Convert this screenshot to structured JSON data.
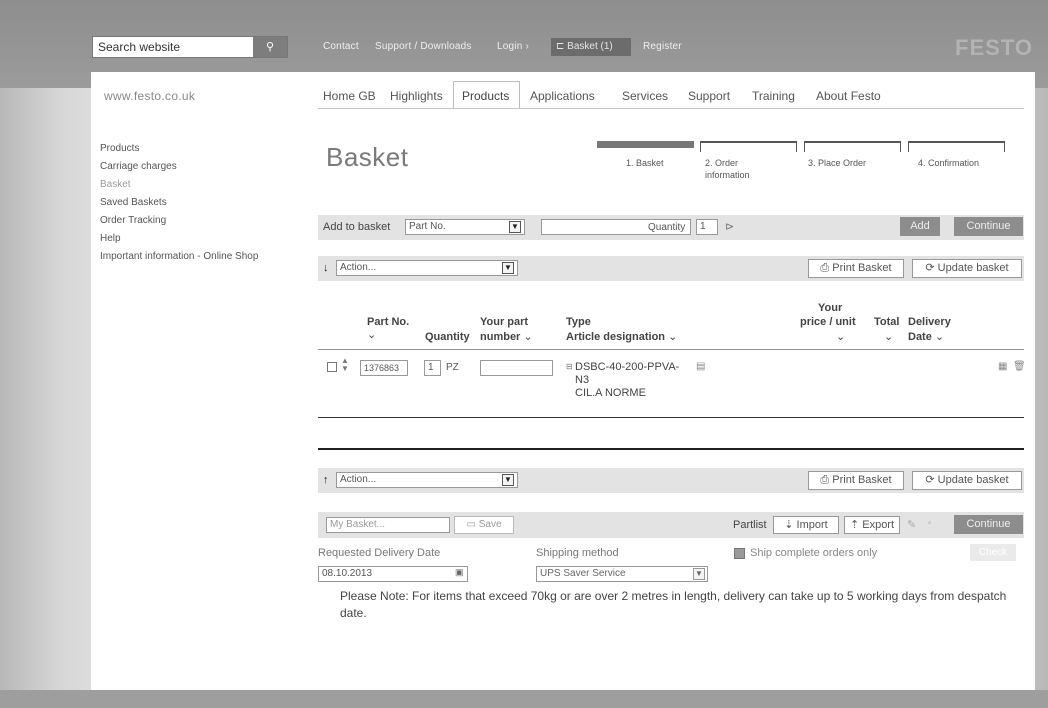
{
  "topbar": {
    "search_placeholder": "Search website",
    "search_icon": "search-icon",
    "links": [
      "Contact",
      "Support / Downloads",
      "Login ›",
      "Register"
    ],
    "basket_label": "Basket (1)",
    "logo": "FESTO"
  },
  "nav": {
    "site": "www.festo.co.uk",
    "items": [
      "Home GB",
      "Highlights",
      "Products",
      "Applications",
      "Services",
      "Support",
      "Training",
      "About Festo"
    ],
    "active": "Products"
  },
  "left_nav": [
    "Products",
    "Carriage charges",
    "Basket",
    "Saved Baskets",
    "Order Tracking",
    "Help",
    "Important information - Online Shop"
  ],
  "page_title": "Basket",
  "steps": [
    {
      "label": "1. Basket"
    },
    {
      "label": "2. Order information"
    },
    {
      "label": "3. Place Order"
    },
    {
      "label": "4. Confirmation"
    }
  ],
  "add_bar": {
    "label": "Add to basket",
    "select_value": "Part No.",
    "quantity_label": "Quantity",
    "quantity_value": "1",
    "add_label": "Add",
    "continue_label": "Continue"
  },
  "action_bar": {
    "action_label": "Action...",
    "print_label": "Print Basket",
    "update_label": "Update basket"
  },
  "table": {
    "headers": {
      "part_no": "Part No.",
      "quantity": "Quantity",
      "your_part": "Your part",
      "number": "number",
      "type": "Type",
      "article": "Article designation",
      "your": "Your",
      "price_unit": "price / unit",
      "total": "Total",
      "delivery": "Delivery",
      "date": "Date"
    },
    "rows": [
      {
        "part_no": "1376863",
        "qty": "1",
        "unit": "PZ",
        "type_line1": "DSBC-40-200-PPVA-",
        "type_line2": "N3",
        "designation": "CIL.A NORME"
      }
    ]
  },
  "bottom": {
    "basket_name_placeholder": "My Basket...",
    "save_label": "Save",
    "partlist_label": "Partlist",
    "import_label": "Import",
    "export_label": "Export",
    "continue_label": "Continue",
    "req_delivery_label": "Requested Delivery Date",
    "req_delivery_value": "08.10.2013",
    "shipping_label": "Shipping method",
    "shipping_value": "UPS Saver Service",
    "ship_complete_label": "Ship complete orders only",
    "check_label": "Check",
    "note": "Please Note: For items that exceed 70kg or are over 2 metres in length, delivery can take up to 5 working days from despatch date."
  },
  "colors": {
    "topbar": "#8e8e8e",
    "button": "#8d8d8d",
    "bar": "#e3e3e3"
  }
}
